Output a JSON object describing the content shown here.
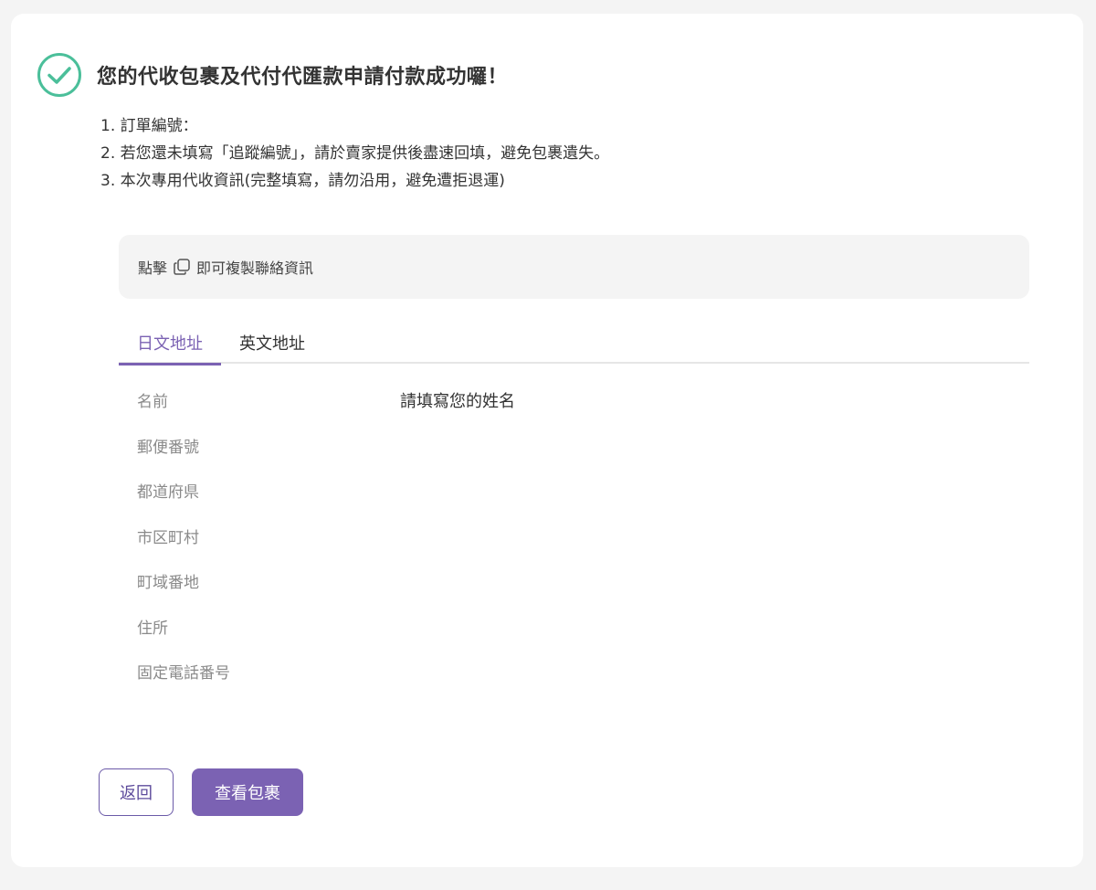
{
  "colors": {
    "accent": "#7b62b3",
    "success": "#4bbf9a",
    "page_background": "#f4f4f4",
    "card_background": "#ffffff"
  },
  "header": {
    "icon": "check-circle-icon",
    "title": "您的代收包裹及代付代匯款申請付款成功囉！"
  },
  "instructions": [
    "1. 訂單編號：",
    "2. 若您還未填寫「追蹤編號」，請於賣家提供後盡速回填，避免包裹遺失。",
    "3. 本次專用代收資訊(完整填寫，請勿沿用，避免遭拒退運)"
  ],
  "copy_bar": {
    "prefix": "點擊",
    "icon": "copy-icon",
    "suffix": "即可複製聯絡資訊"
  },
  "tabs": [
    {
      "label": "日文地址",
      "active": true
    },
    {
      "label": "英文地址",
      "active": false
    }
  ],
  "fields": [
    {
      "label": "名前",
      "value": "請填寫您的姓名"
    },
    {
      "label": "郵便番號",
      "value": ""
    },
    {
      "label": "都道府県",
      "value": ""
    },
    {
      "label": "市区町村",
      "value": ""
    },
    {
      "label": "町域番地",
      "value": ""
    },
    {
      "label": "住所",
      "value": ""
    },
    {
      "label": "固定電話番号",
      "value": ""
    }
  ],
  "buttons": {
    "back_label": "返回",
    "view_label": "查看包裹"
  }
}
